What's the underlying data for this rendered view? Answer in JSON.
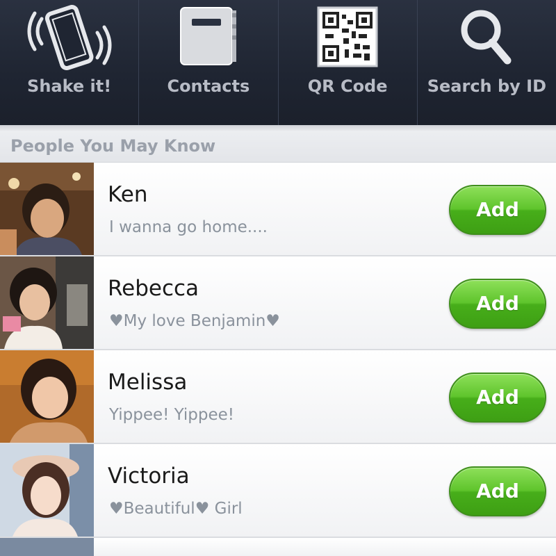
{
  "tabs": [
    {
      "label": "Shake it!",
      "icon": "shake-phone-icon"
    },
    {
      "label": "Contacts",
      "icon": "contacts-book-icon"
    },
    {
      "label": "QR Code",
      "icon": "qr-code-icon"
    },
    {
      "label": "Search by ID",
      "icon": "search-icon"
    }
  ],
  "section_header": "People You May Know",
  "people": [
    {
      "name": "Ken",
      "status": "I wanna go home....",
      "button": "Add"
    },
    {
      "name": "Rebecca",
      "status": "♥My love Benjamin♥",
      "button": "Add"
    },
    {
      "name": "Melissa",
      "status": "Yippee! Yippee!",
      "button": "Add"
    },
    {
      "name": "Victoria",
      "status": "♥Beautiful♥ Girl",
      "button": "Add"
    }
  ],
  "colors": {
    "topbar": "#1f2532",
    "tab_label": "#b8bcc6",
    "add_button": "#5fc42c",
    "status_text": "#8a929c"
  }
}
